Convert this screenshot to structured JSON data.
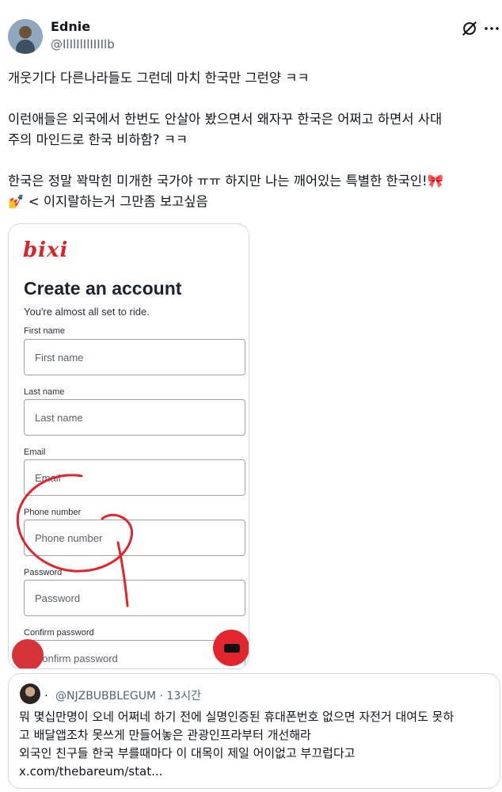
{
  "author": {
    "name": "Ednie",
    "handle": "@IlIlIlIlIIIIlb",
    "avatar_icon": "avatar-image"
  },
  "header_icons": {
    "grok": "grok-icon",
    "more": "more-icon"
  },
  "tweet": {
    "line1": "개웃기다 다른나라들도 그런데 마치 한국만 그런양 ㅋㅋ",
    "line2": "이런애들은 외국에서 한번도 안살아 봤으면서 왜자꾸 한국은 어쩌고 하면서 사대\n주의 마인드로 한국 비하함? ㅋㅋ",
    "line3": "한국은 정말 꽉막힌 미개한 국가야 ㅠㅠ 하지만 나는 깨어있는 특별한 한국인!🎀\n💅 < 이지랄하는거 그만좀 보고싶음"
  },
  "media": {
    "logo": "bixi",
    "title": "Create an account",
    "subtitle": "You're almost all set to ride.",
    "fields": [
      {
        "label": "First name",
        "placeholder": "First name"
      },
      {
        "label": "Last name",
        "placeholder": "Last name"
      },
      {
        "label": "Email",
        "placeholder": "Email"
      },
      {
        "label": "Phone number",
        "placeholder": "Phone number"
      },
      {
        "label": "Password",
        "placeholder": "Password"
      },
      {
        "label": "Confirm password",
        "placeholder": "Confirm password"
      }
    ],
    "annotation_color": "#e0262c",
    "brand_color": "#d6262c"
  },
  "quote": {
    "handle_time": "@NJZBUBBLEGUM · 13시간",
    "text": "뭐 몇십만명이 오네 어쩌네 하기 전에 실명인증된 휴대폰번호 없으면 자전거 대여도 못하\n고 배달앱조차 못쓰게 만들어놓은 관광인프라부터 개선해라\n외국인 친구들 한국 부를때마다 이 대목이 제일 어이없고 부끄럽다고\nx.com/thebareum/stat..."
  }
}
